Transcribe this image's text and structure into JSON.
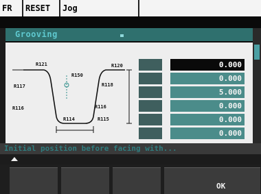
{
  "status_bar": {
    "channel": "FR",
    "reset": "RESET",
    "mode": "Jog"
  },
  "title": "Grooving",
  "diagram": {
    "labels": [
      "R121",
      "R150",
      "R120",
      "R117",
      "R118",
      "R116",
      "R116",
      "R114",
      "R115"
    ]
  },
  "params": [
    {
      "value": "0.000"
    },
    {
      "value": "0.000"
    },
    {
      "value": "5.000"
    },
    {
      "value": "0.000"
    },
    {
      "value": "0.000"
    },
    {
      "value": "0.000"
    }
  ],
  "message": "Initial position before facing with...",
  "softkeys": [
    "",
    "",
    "",
    "",
    "OK"
  ],
  "colors": {
    "accent": "#4b8c8a",
    "title_bg": "#2f706e"
  }
}
